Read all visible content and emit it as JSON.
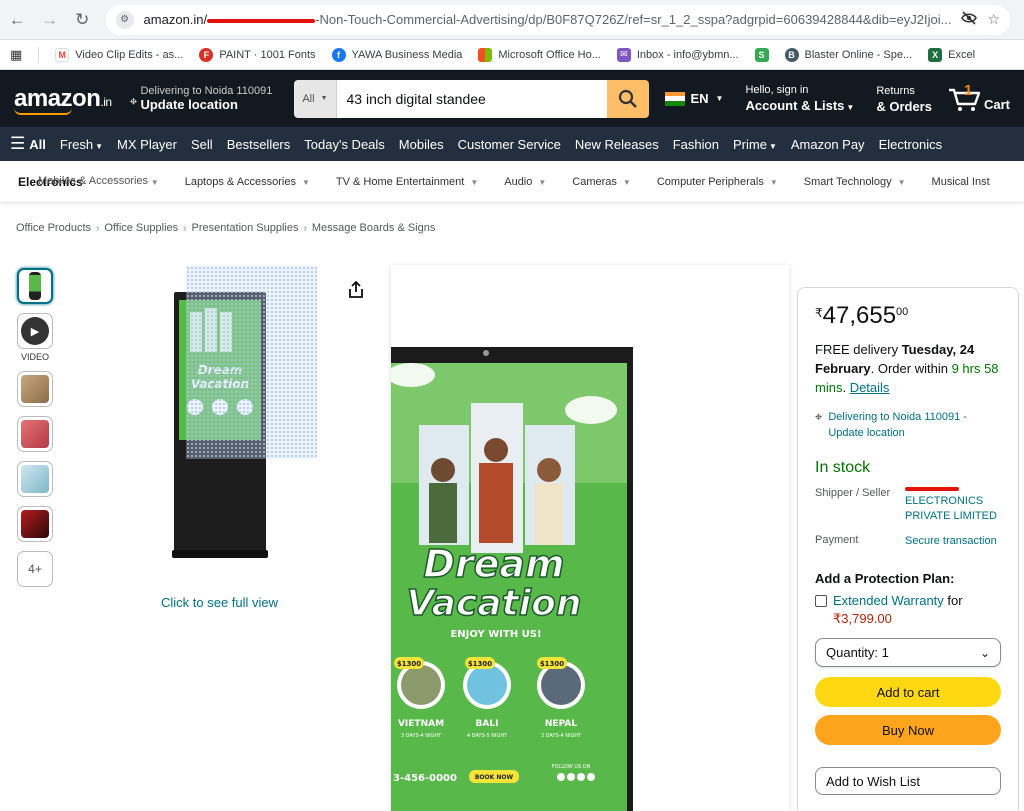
{
  "browser": {
    "url_host": "amazon.in/",
    "url_path": "-Non-Touch-Commercial-Advertising/dp/B0F87Q726Z/ref=sr_1_2_sspa?adgrpid=60639428844&dib=eyJ2Ijoi...",
    "bookmarks": [
      {
        "label": "Video Clip Edits - as...",
        "color": "#ea4335",
        "glyph": "M"
      },
      {
        "label": "PAINT · 1001 Fonts",
        "color": "#d93025",
        "glyph": "F"
      },
      {
        "label": "YAWA Business Media",
        "color": "#1877f2",
        "glyph": "f"
      },
      {
        "label": "Microsoft Office Ho...",
        "color": "#f25022",
        "glyph": "▦"
      },
      {
        "label": "Inbox - info@ybmn...",
        "color": "#7e57c2",
        "glyph": "✉"
      },
      {
        "label": "",
        "color": "#34a853",
        "glyph": "S"
      },
      {
        "label": "Blaster Online - Spe...",
        "color": "#455a64",
        "glyph": "B"
      },
      {
        "label": "Excel",
        "color": "#1d6f42",
        "glyph": "X"
      }
    ]
  },
  "header": {
    "logo_main": "amazon",
    "logo_tld": ".in",
    "deliver_line1": "Delivering to Noida 110091",
    "deliver_line2": "Update location",
    "search_category": "All",
    "search_value": "43 inch digital standee",
    "lang": "EN",
    "account_line1": "Hello, sign in",
    "account_line2": "Account & Lists",
    "orders_line1": "Returns",
    "orders_line2": "& Orders",
    "cart_count": "1",
    "cart_label": "Cart"
  },
  "nav": {
    "all_label": "All",
    "items": [
      "Fresh",
      "MX Player",
      "Sell",
      "Bestsellers",
      "Today's Deals",
      "Mobiles",
      "Customer Service",
      "New Releases",
      "Fashion",
      "Prime",
      "Amazon Pay",
      "Electronics"
    ]
  },
  "subnav": {
    "main": "Electronics",
    "overlay": "Mobiles & Accessories",
    "items": [
      "Laptops & Accessories",
      "TV & Home Entertainment",
      "Audio",
      "Cameras",
      "Computer Peripherals",
      "Smart Technology",
      "Musical Inst"
    ]
  },
  "breadcrumb": [
    "Office Products",
    "Office Supplies",
    "Presentation Supplies",
    "Message Boards & Signs"
  ],
  "gallery": {
    "video_label": "VIDEO",
    "more_label": "4+",
    "full_view": "Click to see full view"
  },
  "poster": {
    "title1": "Dream",
    "title2": "Vacation",
    "subtitle": "ENJOY WITH US!",
    "destinations": [
      {
        "name": "VIETNAM",
        "price": "$1300",
        "days": "3 DAYS-4 NIGHT"
      },
      {
        "name": "BALI",
        "price": "$1300",
        "days": "4 DAYS-5 NIGHT"
      },
      {
        "name": "NEPAL",
        "price": "$1300",
        "days": "3 DAYS-4 NIGHT"
      }
    ],
    "phone": "3-456-0000",
    "book_label": "BOOK NOW",
    "follow": "FOLLOW US ON"
  },
  "buybox": {
    "price_symbol": "₹",
    "price_whole": "47,655",
    "price_fraction": "00",
    "delivery_prefix": "FREE delivery ",
    "delivery_date": "Tuesday, 24 February",
    "delivery_mid": ". Order within ",
    "delivery_time": "9 hrs 58 mins",
    "delivery_dot": ". ",
    "details_link": "Details",
    "location": "Delivering to Noida 110091 - Update location",
    "stock": "In stock",
    "shipper_label": "Shipper / Seller",
    "shipper_value": "ELECTRONICS PRIVATE LIMITED",
    "payment_label": "Payment",
    "payment_value": "Secure transaction",
    "protection_title": "Add a Protection Plan:",
    "warranty_link": "Extended Warranty",
    "warranty_for": " for",
    "warranty_price": "₹3,799.00",
    "quantity": "Quantity: 1",
    "add_to_cart": "Add to cart",
    "buy_now": "Buy Now",
    "wish_list": "Add to Wish List"
  }
}
